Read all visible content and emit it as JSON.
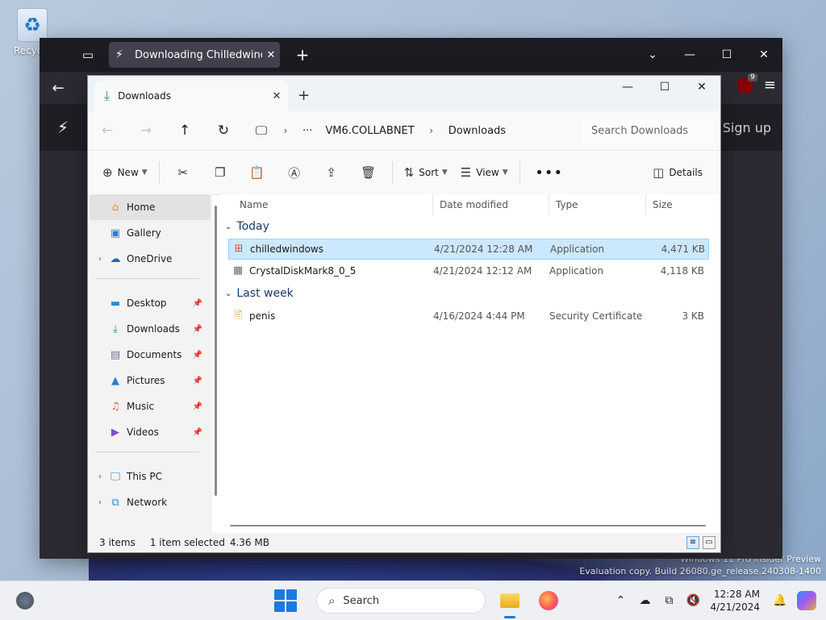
{
  "desktop": {
    "recycle_label": "Recycle",
    "watermark_line1": "Windows 11 Pro Insider Preview",
    "watermark_line2": "Evaluation copy. Build 26080.ge_release.240308-1400"
  },
  "firefox": {
    "tab_title": "Downloading Chilledwindows.exe",
    "ublock_badge": "9",
    "site_signup": "Sign up"
  },
  "explorer": {
    "tab_title": "Downloads",
    "breadcrumb": [
      "VM6.COLLABNET",
      "Downloads"
    ],
    "search_placeholder": "Search Downloads",
    "commands": {
      "new": "New",
      "sort": "Sort",
      "view": "View",
      "details": "Details"
    },
    "nav": {
      "home": "Home",
      "gallery": "Gallery",
      "onedrive": "OneDrive",
      "desktop": "Desktop",
      "downloads": "Downloads",
      "documents": "Documents",
      "pictures": "Pictures",
      "music": "Music",
      "videos": "Videos",
      "thispc": "This PC",
      "network": "Network"
    },
    "columns": {
      "name": "Name",
      "date": "Date modified",
      "type": "Type",
      "size": "Size"
    },
    "groups": [
      {
        "label": "Today",
        "files": [
          {
            "name": "chilledwindows",
            "date": "4/21/2024 12:28 AM",
            "type": "Application",
            "size": "4,471 KB"
          },
          {
            "name": "CrystalDiskMark8_0_5",
            "date": "4/21/2024 12:12 AM",
            "type": "Application",
            "size": "4,118 KB"
          }
        ]
      },
      {
        "label": "Last week",
        "files": [
          {
            "name": "penis",
            "date": "4/16/2024 4:44 PM",
            "type": "Security Certificate",
            "size": "3 KB"
          }
        ]
      }
    ],
    "status": {
      "items": "3 items",
      "selected": "1 item selected",
      "size": "4.36 MB"
    }
  },
  "taskbar": {
    "search_label": "Search",
    "time": "12:28 AM",
    "date": "4/21/2024"
  }
}
